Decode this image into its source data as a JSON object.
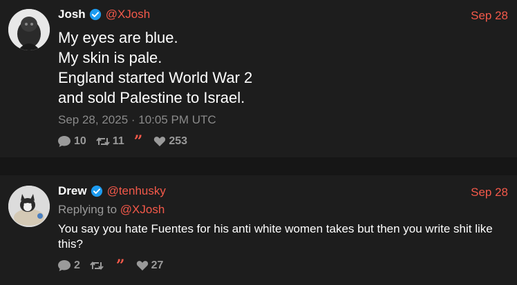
{
  "posts": [
    {
      "author": {
        "name": "Josh",
        "handle": "@XJosh",
        "verified": true
      },
      "date": "Sep 28",
      "lines": [
        "My eyes are blue.",
        "My skin is pale.",
        "England started World War 2",
        "and sold Palestine to Israel."
      ],
      "timestamp": "Sep 28, 2025 · 10:05 PM UTC",
      "stats": {
        "replies": "10",
        "reposts": "11",
        "likes": "253"
      }
    },
    {
      "author": {
        "name": "Drew",
        "handle": "@tenhusky",
        "verified": true
      },
      "date": "Sep 28",
      "replying_prefix": "Replying to",
      "replying_to": "@XJosh",
      "text": "You say you hate Fuentes for his anti white women takes but then you write shit like this?",
      "stats": {
        "replies": "2",
        "reposts": "",
        "likes": "27"
      }
    }
  ],
  "colors": {
    "accent": "#f4594a",
    "verified": "#1d9bf0",
    "background": "#161616",
    "card": "#1d1d1d"
  }
}
